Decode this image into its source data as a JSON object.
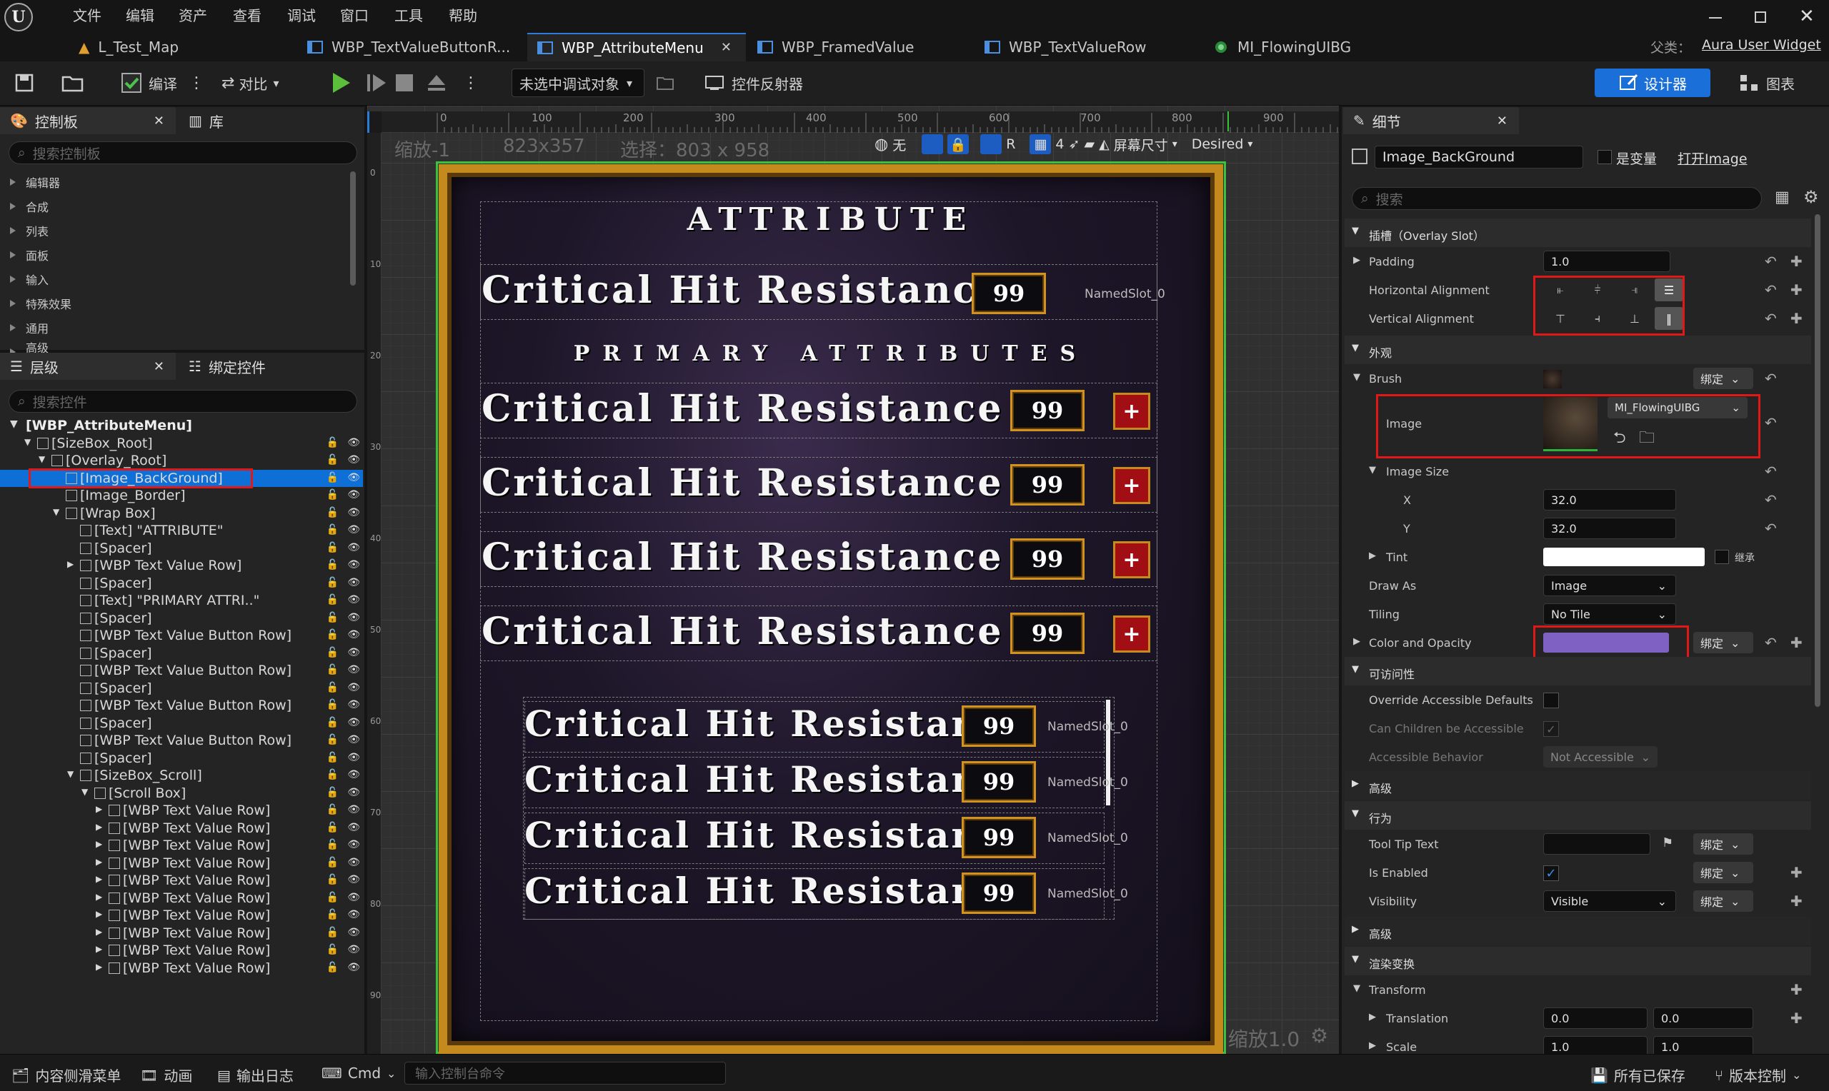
{
  "menu": [
    "文件",
    "编辑",
    "资产",
    "查看",
    "调试",
    "窗口",
    "工具",
    "帮助"
  ],
  "tabs": [
    {
      "label": "L_Test_Map"
    },
    {
      "label": "WBP_TextValueButtonR..."
    },
    {
      "label": "WBP_AttributeMenu",
      "active": true
    },
    {
      "label": "WBP_FramedValue"
    },
    {
      "label": "WBP_TextValueRow"
    },
    {
      "label": "MI_FlowingUIBG"
    }
  ],
  "parent_class": {
    "label": "父类：",
    "value": "Aura User Widget"
  },
  "toolbar": {
    "compile": "编译",
    "diff": "对比",
    "debug_target": "未选中调试对象",
    "reflector": "控件反射器",
    "designer": "设计器",
    "graph": "图表"
  },
  "palette": {
    "tab": "控制板",
    "library_tab": "库",
    "search_placeholder": "搜索控制板",
    "categories": [
      "编辑器",
      "合成",
      "列表",
      "面板",
      "输入",
      "特殊效果",
      "通用",
      "高级"
    ]
  },
  "hierarchy": {
    "tab": "层级",
    "bind_tab": "绑定控件",
    "search_placeholder": "搜索控件",
    "root": "[WBP_AttributeMenu]",
    "items": [
      {
        "label": "[SizeBox_Root]",
        "depth": 1
      },
      {
        "label": "[Overlay_Root]",
        "depth": 2
      },
      {
        "label": "[Image_BackGround]",
        "depth": 3,
        "selected": true
      },
      {
        "label": "[Image_Border]",
        "depth": 3
      },
      {
        "label": "[Wrap Box]",
        "depth": 3
      },
      {
        "label": "[Text] \"ATTRIBUTE\"",
        "depth": 4
      },
      {
        "label": "[Spacer]",
        "depth": 4
      },
      {
        "label": "[WBP Text Value Row]",
        "depth": 4
      },
      {
        "label": "[Spacer]",
        "depth": 4
      },
      {
        "label": "[Text] \"PRIMARY ATTRI..\"",
        "depth": 4
      },
      {
        "label": "[Spacer]",
        "depth": 4
      },
      {
        "label": "[WBP Text Value Button Row]",
        "depth": 4
      },
      {
        "label": "[Spacer]",
        "depth": 4
      },
      {
        "label": "[WBP Text Value Button Row]",
        "depth": 4
      },
      {
        "label": "[Spacer]",
        "depth": 4
      },
      {
        "label": "[WBP Text Value Button Row]",
        "depth": 4
      },
      {
        "label": "[Spacer]",
        "depth": 4
      },
      {
        "label": "[WBP Text Value Button Row]",
        "depth": 4
      },
      {
        "label": "[Spacer]",
        "depth": 4
      },
      {
        "label": "[SizeBox_Scroll]",
        "depth": 4
      },
      {
        "label": "[Scroll Box]",
        "depth": 5
      },
      {
        "label": "[WBP Text Value Row]",
        "depth": 6
      },
      {
        "label": "[WBP Text Value Row]",
        "depth": 6
      },
      {
        "label": "[WBP Text Value Row]",
        "depth": 6
      },
      {
        "label": "[WBP Text Value Row]",
        "depth": 6
      },
      {
        "label": "[WBP Text Value Row]",
        "depth": 6
      },
      {
        "label": "[WBP Text Value Row]",
        "depth": 6
      },
      {
        "label": "[WBP Text Value Row]",
        "depth": 6
      },
      {
        "label": "[WBP Text Value Row]",
        "depth": 6
      },
      {
        "label": "[WBP Text Value Row]",
        "depth": 6
      },
      {
        "label": "[WBP Text Value Row]",
        "depth": 6
      }
    ]
  },
  "viewport": {
    "zoom": "缩放-1",
    "size": "823x357",
    "selection": "选择：803 x 958",
    "none_label": "无",
    "r_label": "R",
    "grid_count": "4",
    "screen_size": "屏幕尺寸",
    "desired": "Desired",
    "dpi": "DPI缩放1.0",
    "ruler_h": [
      "0",
      "100",
      "200",
      "300",
      "400",
      "500",
      "600",
      "700",
      "800",
      "900"
    ],
    "ruler_v": [
      "0",
      "100",
      "200",
      "300",
      "400",
      "500",
      "600",
      "700",
      "800",
      "900"
    ]
  },
  "menu_widget": {
    "title": "ATTRIBUTE",
    "primary_title": "PRIMARY ATTRIBUTES",
    "row_label": "Critical Hit Resistance",
    "value": "99",
    "named_slot": "NamedSlot_0",
    "plus": "+"
  },
  "details": {
    "tab": "细节",
    "widget_name": "Image_BackGround",
    "is_variable": "是变量",
    "open_image": "打开Image",
    "search_placeholder": "搜索",
    "slot_section": "插槽（Overlay Slot）",
    "padding_label": "Padding",
    "padding_value": "1.0",
    "h_align_label": "Horizontal Alignment",
    "v_align_label": "Vertical Alignment",
    "appearance_section": "外观",
    "brush_label": "Brush",
    "bind_label": "绑定",
    "image_label": "Image",
    "image_asset": "MI_FlowingUIBG",
    "image_size_label": "Image Size",
    "x_label": "X",
    "x_value": "32.0",
    "y_label": "Y",
    "y_value": "32.0",
    "tint_label": "Tint",
    "inherit_label": "继承",
    "draw_as_label": "Draw As",
    "draw_as_value": "Image",
    "tiling_label": "Tiling",
    "tiling_value": "No Tile",
    "color_label": "Color and Opacity",
    "color_value": "#7f61c4",
    "accessibility_section": "可访问性",
    "override_label": "Override Accessible Defaults",
    "children_label": "Can Children be Accessible",
    "behavior_label": "Accessible Behavior",
    "behavior_value": "Not Accessible",
    "advanced_label": "高级",
    "behavior_section": "行为",
    "tooltip_label": "Tool Tip Text",
    "enabled_label": "Is Enabled",
    "visibility_label": "Visibility",
    "visibility_value": "Visible",
    "render_section": "渲染变换",
    "transform_label": "Transform",
    "translation_label": "Translation",
    "translation_x": "0.0",
    "translation_y": "0.0",
    "scale_label": "Scale",
    "scale_x": "1.0",
    "scale_y": "1.0"
  },
  "bottom": {
    "content_drawer": "内容侧滑菜单",
    "animation": "动画",
    "output_log": "输出日志",
    "cmd": "Cmd",
    "console_placeholder": "输入控制台命令",
    "saved": "所有已保存",
    "source_control": "版本控制"
  }
}
